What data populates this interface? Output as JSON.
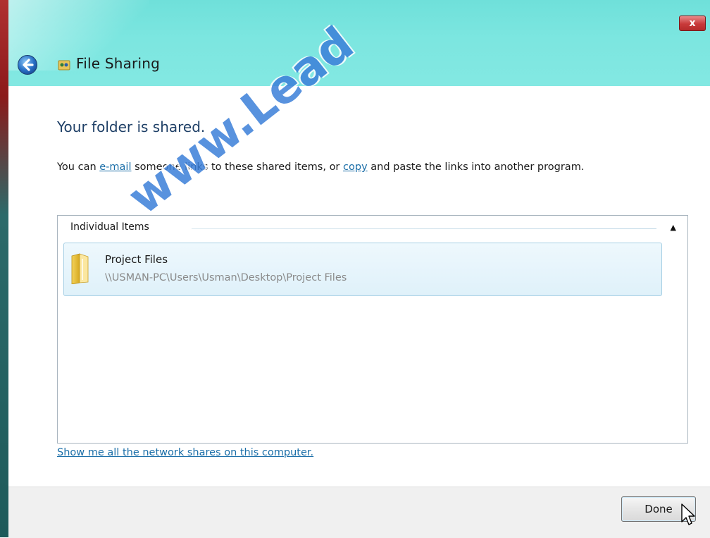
{
  "window": {
    "title": "File Sharing",
    "close_label": "x"
  },
  "content": {
    "heading": "Your folder is shared.",
    "desc_before_email": "You can ",
    "email_link": "e-mail",
    "desc_middle": " someone links to these shared items, or ",
    "copy_link": "copy",
    "desc_after_copy": " and paste the links into another program."
  },
  "list": {
    "group_header": "Individual Items",
    "items": [
      {
        "name": "Project Files",
        "path": "\\\\USMAN-PC\\Users\\Usman\\Desktop\\Project Files",
        "icon": "folder-icon"
      }
    ]
  },
  "footer": {
    "network_link": "Show me all the network shares on this computer.",
    "done_label": "Done"
  },
  "watermark": {
    "text": "www.Lead"
  },
  "colors": {
    "title_bar": "#7ce6e0",
    "link": "#1a6ea8",
    "heading": "#1e3f66",
    "item_selected_bg": "#dff1fa",
    "close_button": "#c83a3a",
    "watermark": "#3b7fd9"
  }
}
